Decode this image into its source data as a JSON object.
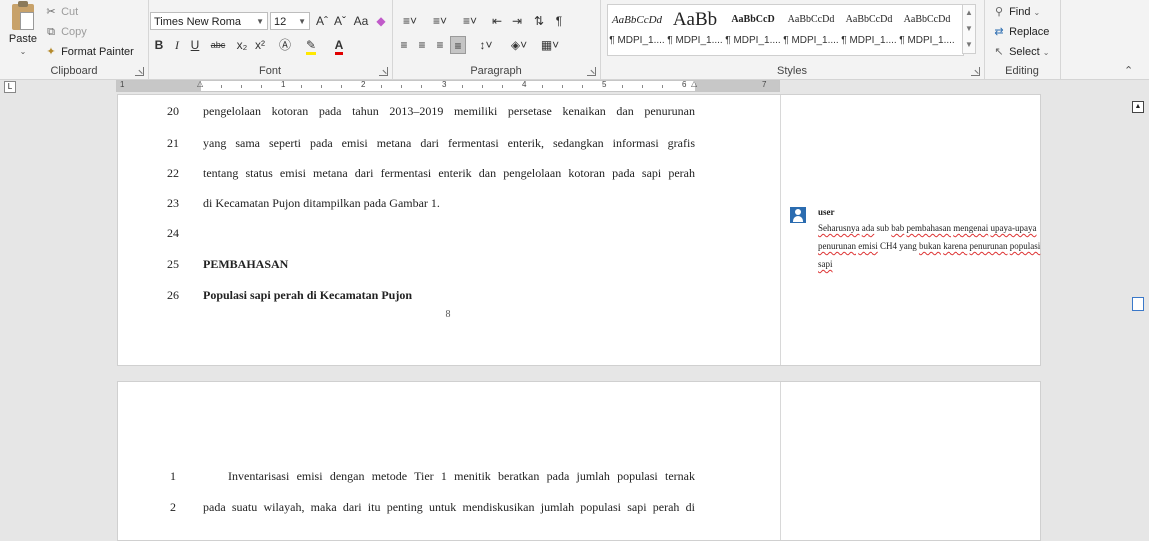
{
  "ribbon": {
    "clipboard": {
      "paste": "Paste",
      "cut": "Cut",
      "copy": "Copy",
      "format_painter": "Format Painter",
      "label": "Clipboard"
    },
    "font": {
      "name": "Times New Roma",
      "size": "12",
      "grow": "Aˆ",
      "shrink": "Aˇ",
      "case": "Aa",
      "bold": "B",
      "italic": "I",
      "underline": "U",
      "strike": "abc",
      "subscript": "x₂",
      "superscript": "x²",
      "label": "Font"
    },
    "paragraph": {
      "label": "Paragraph",
      "pilcrow": "¶"
    },
    "styles": {
      "label": "Styles",
      "items": [
        {
          "preview": "AaBbCcDd",
          "name": "¶ MDPI_1...."
        },
        {
          "preview": "AaBb",
          "name": "¶ MDPI_1...."
        },
        {
          "preview": "AaBbCcD",
          "name": "¶ MDPI_1...."
        },
        {
          "preview": "AaBbCcDd",
          "name": "¶ MDPI_1...."
        },
        {
          "preview": "AaBbCcDd",
          "name": "¶ MDPI_1...."
        },
        {
          "preview": "AaBbCcDd",
          "name": "¶ MDPI_1...."
        }
      ]
    },
    "editing": {
      "find": "Find",
      "replace": "Replace",
      "select": "Select",
      "label": "Editing"
    }
  },
  "ruler": {
    "numbers": [
      "1",
      "1",
      "2",
      "3",
      "4",
      "5",
      "6",
      "7"
    ]
  },
  "page1": {
    "lines": [
      {
        "num": "20",
        "text": "pengelolaan kotoran pada tahun 2013–2019 memiliki persetase kenaikan dan penurunan"
      },
      {
        "num": "21",
        "text": "yang sama seperti pada emisi metana dari fermentasi enterik, sedangkan informasi grafis"
      },
      {
        "num": "22",
        "text": "tentang status emisi metana dari fermentasi enterik dan pengelolaan kotoran pada sapi perah"
      },
      {
        "num": "23",
        "text": "di Kecamatan Pujon ditampilkan pada Gambar 1."
      },
      {
        "num": "24",
        "text": ""
      },
      {
        "num": "25",
        "text": "PEMBAHASAN"
      },
      {
        "num": "26",
        "text": "Populasi sapi perah di Kecamatan Pujon"
      }
    ],
    "page_number": "8"
  },
  "comment": {
    "author": "user",
    "parts": [
      {
        "t": "Seharusnya",
        "s": true
      },
      {
        "t": " "
      },
      {
        "t": "ada",
        "s": true
      },
      {
        "t": " sub "
      },
      {
        "t": "bab",
        "s": true
      },
      {
        "t": " "
      },
      {
        "t": "pembahasan",
        "s": true
      },
      {
        "t": " "
      },
      {
        "t": "mengenai",
        "s": true
      },
      {
        "t": " "
      },
      {
        "t": "upaya-upaya",
        "s": true
      },
      {
        "t": " "
      },
      {
        "t": "penurunan",
        "s": true
      },
      {
        "t": " "
      },
      {
        "t": "emisi",
        "s": true
      },
      {
        "t": " CH4 yang "
      },
      {
        "t": "bukan",
        "s": true
      },
      {
        "t": " "
      },
      {
        "t": "karena",
        "s": true
      },
      {
        "t": " "
      },
      {
        "t": "penurunan",
        "s": true
      },
      {
        "t": " "
      },
      {
        "t": "populasi",
        "s": true
      },
      {
        "t": " "
      },
      {
        "t": "sapi",
        "s": true
      }
    ]
  },
  "page2": {
    "lines": [
      {
        "num": "1",
        "text": "Inventarisasi emisi dengan metode Tier 1 menitik beratkan pada jumlah populasi ternak"
      },
      {
        "num": "2",
        "text": "pada suatu wilayah, maka dari itu penting untuk mendiskusikan jumlah populasi sapi perah di"
      }
    ]
  }
}
